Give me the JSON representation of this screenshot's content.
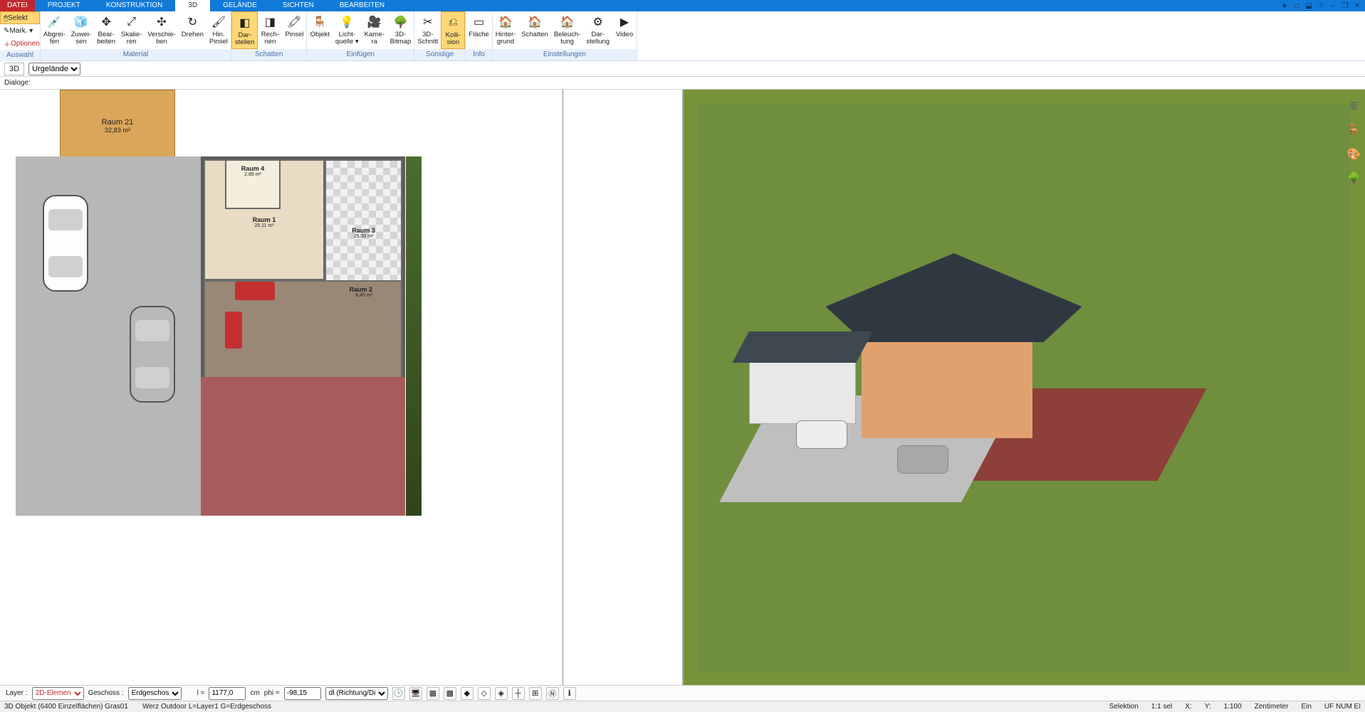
{
  "tabs": {
    "file": "DATEI",
    "items": [
      "PROJEKT",
      "KONSTRUKTION",
      "3D",
      "GELÄNDE",
      "SICHTEN",
      "BEARBEITEN"
    ],
    "activeIndex": 2
  },
  "titleIcons": [
    "★",
    "□",
    "⬓",
    "?",
    "–",
    "❐",
    "✕"
  ],
  "ribbon": {
    "auswahl": {
      "label": "Auswahl",
      "btns": [
        "Selekt",
        "Mark. ▾",
        "Optionen"
      ]
    },
    "material": {
      "label": "Material",
      "btns": [
        {
          "l": "Abgrei-\nfen"
        },
        {
          "l": "Zuwei-\nsen"
        },
        {
          "l": "Bear-\nbeiten"
        },
        {
          "l": "Skalie-\nren"
        },
        {
          "l": "Verschie-\nben"
        },
        {
          "l": "Drehen"
        },
        {
          "l": "Hin.\nPinsel"
        }
      ]
    },
    "schatten": {
      "label": "Schatten",
      "btns": [
        {
          "l": "Dar-\nstellen",
          "active": true
        },
        {
          "l": "Rech-\nnen"
        },
        {
          "l": "Pinsel"
        }
      ]
    },
    "einfuegen": {
      "label": "Einfügen",
      "btns": [
        {
          "l": "Objekt"
        },
        {
          "l": "Licht-\nquelle ▾"
        },
        {
          "l": "Kame-\nra"
        },
        {
          "l": "3D-\nBitmap"
        }
      ]
    },
    "sonstige": {
      "label": "Sonstige",
      "btns": [
        {
          "l": "3D-\nSchnitt"
        },
        {
          "l": "Kolli-\nsion",
          "active": true
        }
      ]
    },
    "info": {
      "label": "Info",
      "btns": [
        {
          "l": "Fläche"
        }
      ]
    },
    "einstellungen": {
      "label": "Einstellungen",
      "btns": [
        {
          "l": "Hinter-\ngrund"
        },
        {
          "l": "Schatten"
        },
        {
          "l": "Beleuch-\ntung"
        },
        {
          "l": "Dar-\nstellung"
        },
        {
          "l": "Video"
        }
      ]
    }
  },
  "subbar": {
    "mode": "3D",
    "subject": "Urgelände"
  },
  "dialogbar": {
    "label": "Dialoge:"
  },
  "floorplan": {
    "shed": {
      "name": "Raum 21",
      "size": "32,83 m²"
    },
    "r4": {
      "name": "Raum 4",
      "size": "2,89 m²"
    },
    "r1": {
      "name": "Raum 1",
      "size": "20,11 m²"
    },
    "r3": {
      "name": "Raum 3",
      "size": "25,00 m²"
    },
    "r2": {
      "name": "Raum 2",
      "size": "6,45 m²"
    }
  },
  "bottombar": {
    "layerLabel": "Layer :",
    "layer": "2D-Elemen",
    "geschossLabel": "Geschoss :",
    "geschoss": "Erdgeschos",
    "lLabel": "l =",
    "lValue": "1177,0",
    "unit": "cm",
    "phiLabel": "phi =",
    "phiValue": "-98,15",
    "dl": "dl (Richtung/Di"
  },
  "status": {
    "left1": "3D Objekt (6400 Einzelflächen) Gras01",
    "left2": "Werz Outdoor L=Layer1 G=Erdgeschoss",
    "sel": "Selektion",
    "ratio": "1:1 sel",
    "x": "X:",
    "y": "Y:",
    "scale": "1:100",
    "unit": "Zentimeter",
    "ein": "Ein",
    "uf": "UF NUM EI"
  }
}
